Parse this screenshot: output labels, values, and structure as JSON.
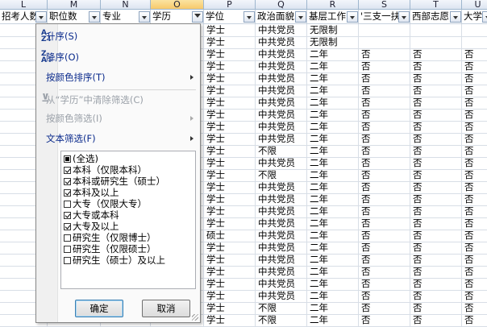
{
  "column_letters": [
    "L",
    "M",
    "N",
    "O",
    "P",
    "Q",
    "R",
    "S",
    "T",
    "U"
  ],
  "active_column": "O",
  "headers": [
    "招考人数",
    "职位数",
    "专业",
    "学历",
    "学位",
    "政治面貌",
    "基层工作",
    "'三支一扶",
    "西部志愿",
    "大学生"
  ],
  "rows": [
    [
      "学士",
      "中共党员",
      "无限制",
      "",
      "",
      ""
    ],
    [
      "学士",
      "中共党员",
      "无限制",
      "",
      "",
      ""
    ],
    [
      "学士",
      "中共党员",
      "二年",
      "否",
      "否",
      "否"
    ],
    [
      "学士",
      "中共党员",
      "二年",
      "否",
      "否",
      "否"
    ],
    [
      "学士",
      "中共党员",
      "二年",
      "否",
      "否",
      "否"
    ],
    [
      "学士",
      "中共党员",
      "二年",
      "否",
      "否",
      "否"
    ],
    [
      "学士",
      "中共党员",
      "二年",
      "否",
      "否",
      "否"
    ],
    [
      "学士",
      "中共党员",
      "二年",
      "否",
      "否",
      "否"
    ],
    [
      "学士",
      "中共党员",
      "二年",
      "否",
      "否",
      "否"
    ],
    [
      "学士",
      "中共党员",
      "二年",
      "否",
      "否",
      "否"
    ],
    [
      "学士",
      "不限",
      "二年",
      "否",
      "否",
      "否"
    ],
    [
      "学士",
      "中共党员",
      "二年",
      "否",
      "否",
      "否"
    ],
    [
      "学士",
      "不限",
      "二年",
      "否",
      "否",
      "否"
    ],
    [
      "学士",
      "中共党员",
      "二年",
      "否",
      "否",
      "否"
    ],
    [
      "学士",
      "中共党员",
      "二年",
      "否",
      "否",
      "否"
    ],
    [
      "学士",
      "中共党员",
      "二年",
      "否",
      "否",
      "否"
    ],
    [
      "学士",
      "中共党员",
      "二年",
      "否",
      "否",
      "否"
    ],
    [
      "硕士",
      "中共党员",
      "二年",
      "否",
      "否",
      "否"
    ],
    [
      "学士",
      "中共党员",
      "二年",
      "否",
      "否",
      "否"
    ],
    [
      "学士",
      "中共党员",
      "二年",
      "否",
      "否",
      "否"
    ],
    [
      "学士",
      "中共党员",
      "二年",
      "否",
      "否",
      "否"
    ],
    [
      "学士",
      "中共党员",
      "二年",
      "否",
      "否",
      "否"
    ],
    [
      "学士",
      "中共党员",
      "二年",
      "否",
      "否",
      "否"
    ],
    [
      "学士",
      "不限",
      "二年",
      "否",
      "否",
      "否"
    ],
    [
      "学士",
      "不限",
      "二年",
      "否",
      "否",
      "否"
    ]
  ],
  "menu": {
    "sort_asc": "升序(S)",
    "sort_desc": "降序(O)",
    "sort_by_color": "按颜色排序(T)",
    "clear_filter": "从“学历”中清除筛选(C)",
    "filter_by_color": "按颜色筛选(I)",
    "text_filters": "文本筛选(F)",
    "ok": "确定",
    "cancel": "取消"
  },
  "filter_items": [
    {
      "label": "(全选)",
      "state": "mixed"
    },
    {
      "label": "本科（仅限本科）",
      "state": "on"
    },
    {
      "label": "本科或研究生（硕士）",
      "state": "on"
    },
    {
      "label": "本科及以上",
      "state": "on"
    },
    {
      "label": "大专（仅限大专）",
      "state": "off"
    },
    {
      "label": "大专或本科",
      "state": "on"
    },
    {
      "label": "大专及以上",
      "state": "on"
    },
    {
      "label": "研究生（仅限博士）",
      "state": "off"
    },
    {
      "label": "研究生（仅限硕士）",
      "state": "off"
    },
    {
      "label": "研究生（硕士）及以上",
      "state": "off"
    }
  ],
  "colors": {
    "link_text": "#0a2a8c",
    "disabled_text": "#9aa0a8",
    "active_column": "#f7c96b"
  }
}
